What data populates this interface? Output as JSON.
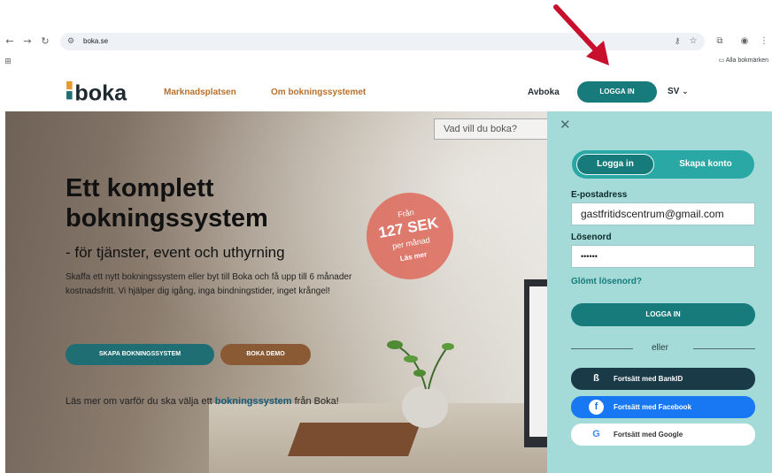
{
  "browser": {
    "back_icon": "arrow-left-icon",
    "forward_icon": "arrow-right-icon",
    "reload_icon": "reload-icon",
    "url": "boka.se",
    "bookmarks_label": "Alla bokmärken"
  },
  "header": {
    "logo_text": "boka",
    "nav": [
      "Marknadsplatsen",
      "Om bokningssystemet"
    ],
    "avboka": "Avboka",
    "login_button": "LOGGA IN",
    "language": "SV",
    "accent_color": "#187b7b",
    "nav_color": "#b7702c"
  },
  "hero": {
    "search_placeholder": "Vad vill du boka?",
    "title": "Ett komplett bokningssystem",
    "subtitle": "- för tjänster, event och uthyrning",
    "text": "Skaffa ett nytt bokningssystem eller byt till Boka och få upp till 6 månader kostnadsfritt. Vi hjälper dig igång, inga bindningstider, inget krångel!",
    "create_button": "SKAPA BOKNINGSSYSTEM",
    "demo_button": "BOKA DEMO",
    "more_prefix": "Läs mer om varför du ska välja ett ",
    "more_link": "bokningssystem",
    "more_suffix": " från Boka!",
    "price": {
      "from": "Från",
      "amount": "127 SEK",
      "period": "per månad",
      "read_more": "Läs mer"
    }
  },
  "login_panel": {
    "tab_login": "Logga in",
    "tab_register": "Skapa konto",
    "email_label": "E-postadress",
    "email_value": "gastfritidscentrum@gmail.com",
    "password_label": "Lösenord",
    "password_value": "••••••",
    "forgot": "Glömt lösenord?",
    "submit": "LOGGA IN",
    "or": "eller",
    "bankid": "Fortsätt med BankID",
    "facebook": "Fortsätt med Facebook",
    "google": "Fortsätt med Google",
    "panel_color": "#a4dbd9"
  }
}
